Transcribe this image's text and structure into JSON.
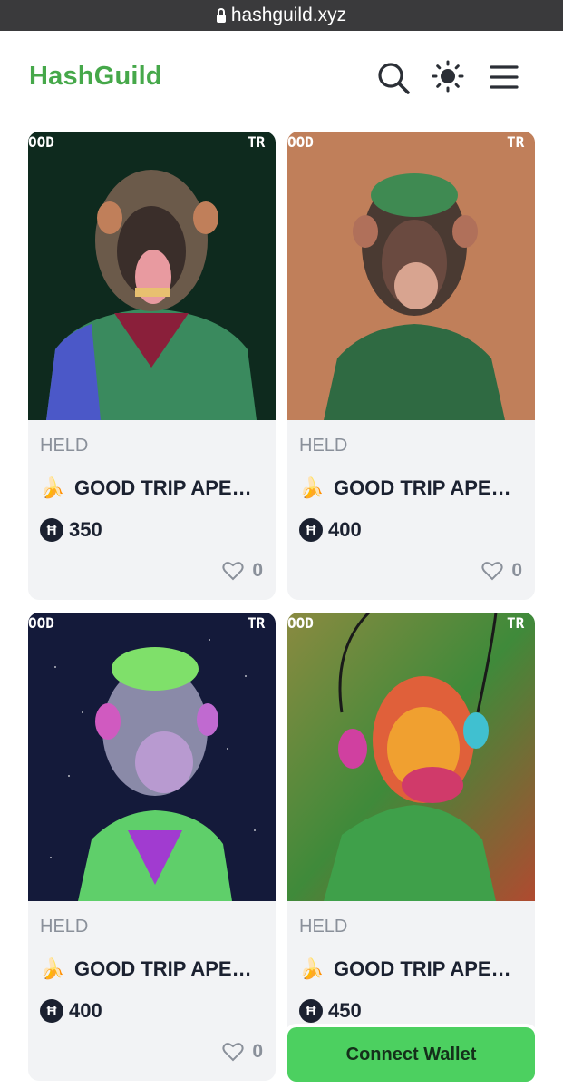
{
  "browser": {
    "url": "hashguild.xyz"
  },
  "header": {
    "logo": "HashGuild",
    "icons": [
      "search-icon",
      "sun-icon",
      "menu-icon"
    ]
  },
  "colors": {
    "brand": "#46a84a",
    "connect": "#4cd060",
    "card_bg": "#f2f3f5",
    "hbar": "#1b2130"
  },
  "cards": [
    {
      "status": "HELD",
      "emoji": "🍌",
      "title": "GOOD TRIP APE…",
      "currency_symbol": "Ħ",
      "price": "350",
      "likes": "0",
      "art_text_left": "OOD",
      "art_text_right": "TR",
      "art_side": "9\n20",
      "bg": "#0e2a1e"
    },
    {
      "status": "HELD",
      "emoji": "🍌",
      "title": "GOOD TRIP APE…",
      "currency_symbol": "Ħ",
      "price": "400",
      "likes": "0",
      "art_text_left": "OOD",
      "art_text_right": "TR",
      "art_side": "21\n20",
      "bg": "#c07f5a"
    },
    {
      "status": "HELD",
      "emoji": "🍌",
      "title": "GOOD TRIP APE…",
      "currency_symbol": "Ħ",
      "price": "400",
      "likes": "0",
      "art_text_left": "OOD",
      "art_text_right": "TR",
      "art_side": "4\n20",
      "bg": "#141a3a"
    },
    {
      "status": "HELD",
      "emoji": "🍌",
      "title": "GOOD TRIP APE…",
      "currency_symbol": "Ħ",
      "price": "450",
      "likes": "",
      "art_text_left": "OOD",
      "art_text_right": "TR",
      "art_side": "",
      "bg": "#4a7a3a"
    }
  ],
  "connect_wallet": "Connect Wallet"
}
